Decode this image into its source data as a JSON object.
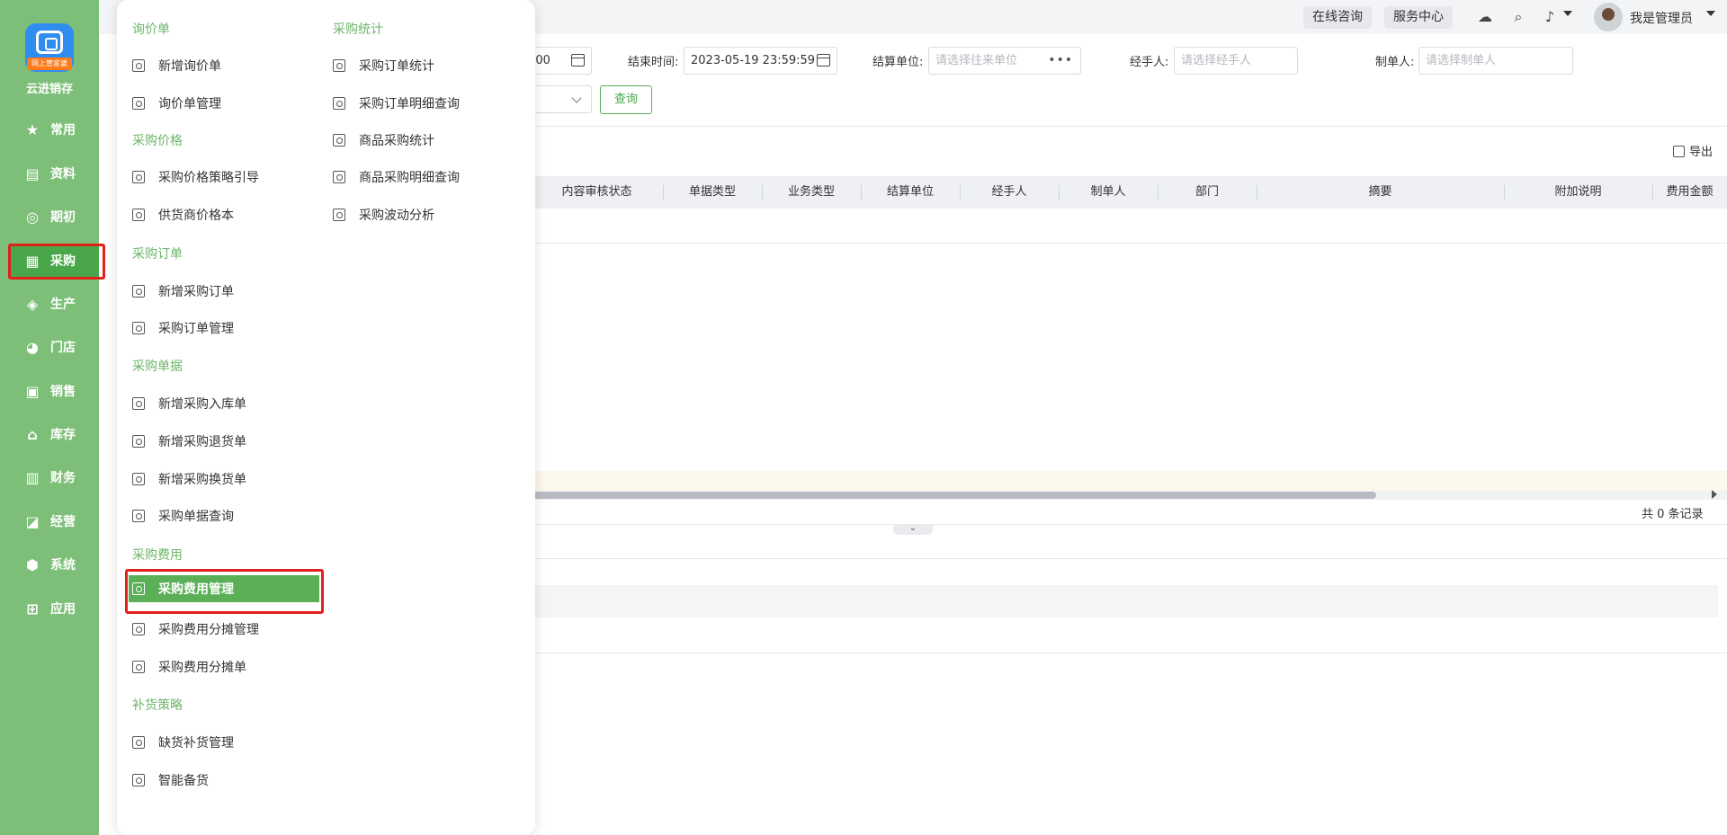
{
  "brand": {
    "badge_text": "网上管家婆",
    "name": "云进销存"
  },
  "nav": [
    {
      "label": "常用",
      "icon": "star-icon"
    },
    {
      "label": "资料",
      "icon": "document-icon"
    },
    {
      "label": "期初",
      "icon": "target-icon"
    },
    {
      "label": "采购",
      "icon": "purchase-icon"
    },
    {
      "label": "生产",
      "icon": "production-icon"
    },
    {
      "label": "门店",
      "icon": "pie-icon"
    },
    {
      "label": "销售",
      "icon": "sales-icon"
    },
    {
      "label": "库存",
      "icon": "warehouse-icon"
    },
    {
      "label": "财务",
      "icon": "finance-icon"
    },
    {
      "label": "经营",
      "icon": "chart-icon"
    },
    {
      "label": "系统",
      "icon": "settings-icon"
    },
    {
      "label": "应用",
      "icon": "plus-icon"
    }
  ],
  "header": {
    "online_consult": "在线咨询",
    "service_center": "服务中心",
    "admin_name": "我是管理员"
  },
  "filters": {
    "start_time_partial": ":00",
    "end_time_label": "结束时间:",
    "end_time_value": "2023-05-19 23:59:59",
    "settle_unit_label": "结算单位:",
    "settle_unit_placeholder": "请选择往来单位",
    "handler_label": "经手人:",
    "handler_placeholder": "请选择经手人",
    "maker_label": "制单人:",
    "maker_placeholder": "请选择制单人",
    "query_button": "查询"
  },
  "table": {
    "export_label": "导出",
    "columns": [
      "内容审核状态",
      "单据类型",
      "业务类型",
      "结算单位",
      "经手人",
      "制单人",
      "部门",
      "摘要",
      "附加说明",
      "费用金额"
    ],
    "record_count": "共 0 条记录"
  },
  "menu": {
    "left": [
      {
        "title": "询价单",
        "items": [
          "新增询价单",
          "询价单管理"
        ]
      },
      {
        "title": "采购价格",
        "items": [
          "采购价格策略引导",
          "供货商价格本"
        ]
      },
      {
        "title": "采购订单",
        "items": [
          "新增采购订单",
          "采购订单管理"
        ]
      },
      {
        "title": "采购单据",
        "items": [
          "新增采购入库单",
          "新增采购退货单",
          "新增采购换货单",
          "采购单据查询"
        ]
      },
      {
        "title": "采购费用",
        "items": [
          "采购费用管理",
          "采购费用分摊管理",
          "采购费用分摊单"
        ]
      },
      {
        "title": "补货策略",
        "items": [
          "缺货补货管理",
          "智能备货"
        ]
      }
    ],
    "right": [
      {
        "title": "采购统计",
        "items": [
          "采购订单统计",
          "采购订单明细查询",
          "商品采购统计",
          "商品采购明细查询",
          "采购波动分析"
        ]
      }
    ],
    "active_item": "采购费用管理"
  }
}
